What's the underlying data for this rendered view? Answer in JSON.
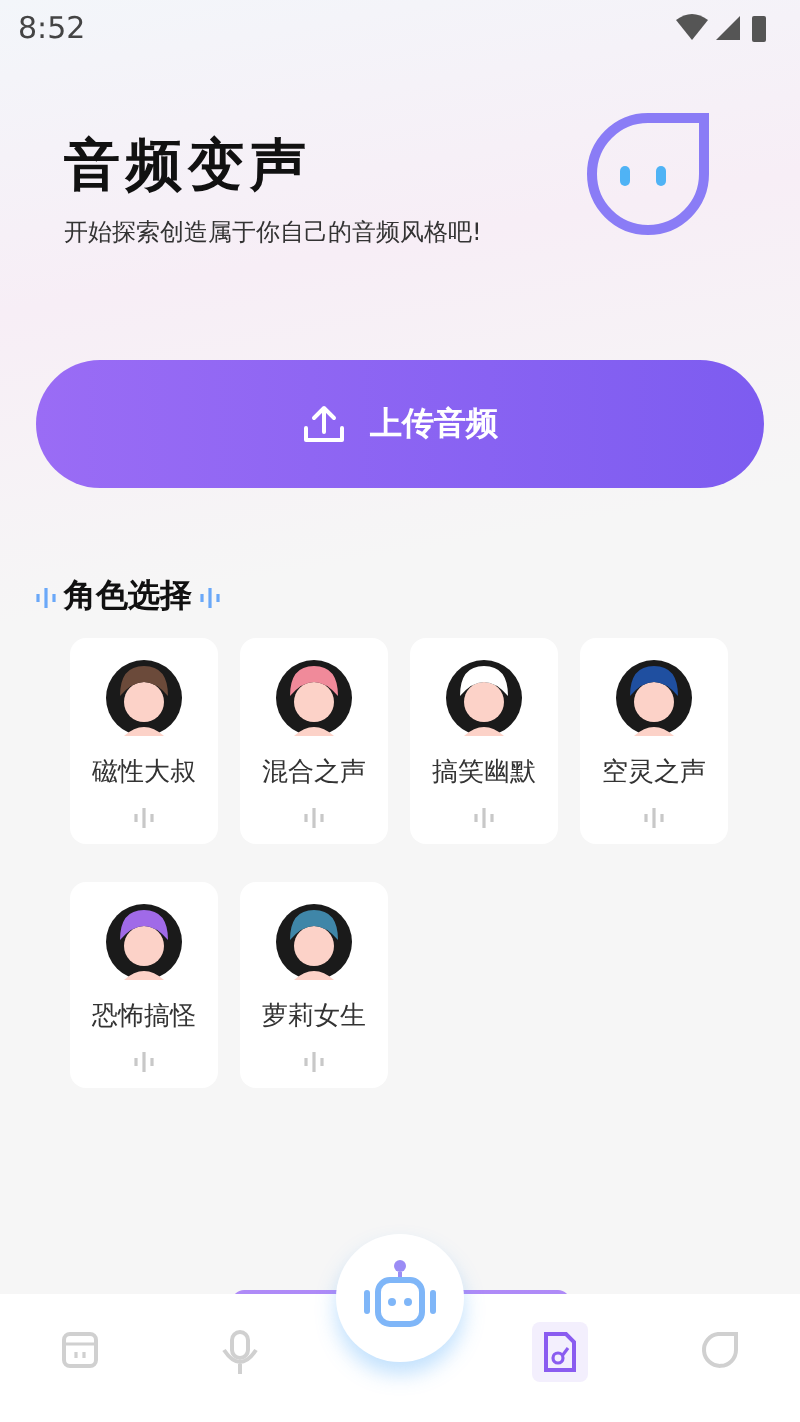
{
  "status_bar": {
    "time": "8:52"
  },
  "header": {
    "title": "音频变声",
    "subtitle": "开始探索创造属于你自己的音频风格吧!"
  },
  "upload_button": {
    "label": "上传音频"
  },
  "section": {
    "title": "角色选择"
  },
  "roles": [
    {
      "name": "磁性大叔",
      "color": "#6b4a3a"
    },
    {
      "name": "混合之声",
      "color": "#f08a9a"
    },
    {
      "name": "搞笑幽默",
      "color": "#ffffff"
    },
    {
      "name": "空灵之声",
      "color": "#1f4fa0"
    },
    {
      "name": "恐怖搞怪",
      "color": "#a06ae8"
    },
    {
      "name": "萝莉女生",
      "color": "#3f86a8"
    }
  ],
  "nav": [
    {
      "kind": "player",
      "selected": false
    },
    {
      "kind": "mic",
      "selected": false
    },
    {
      "kind": "robot",
      "selected": false
    },
    {
      "kind": "file",
      "selected": true
    },
    {
      "kind": "drop",
      "selected": false
    }
  ]
}
